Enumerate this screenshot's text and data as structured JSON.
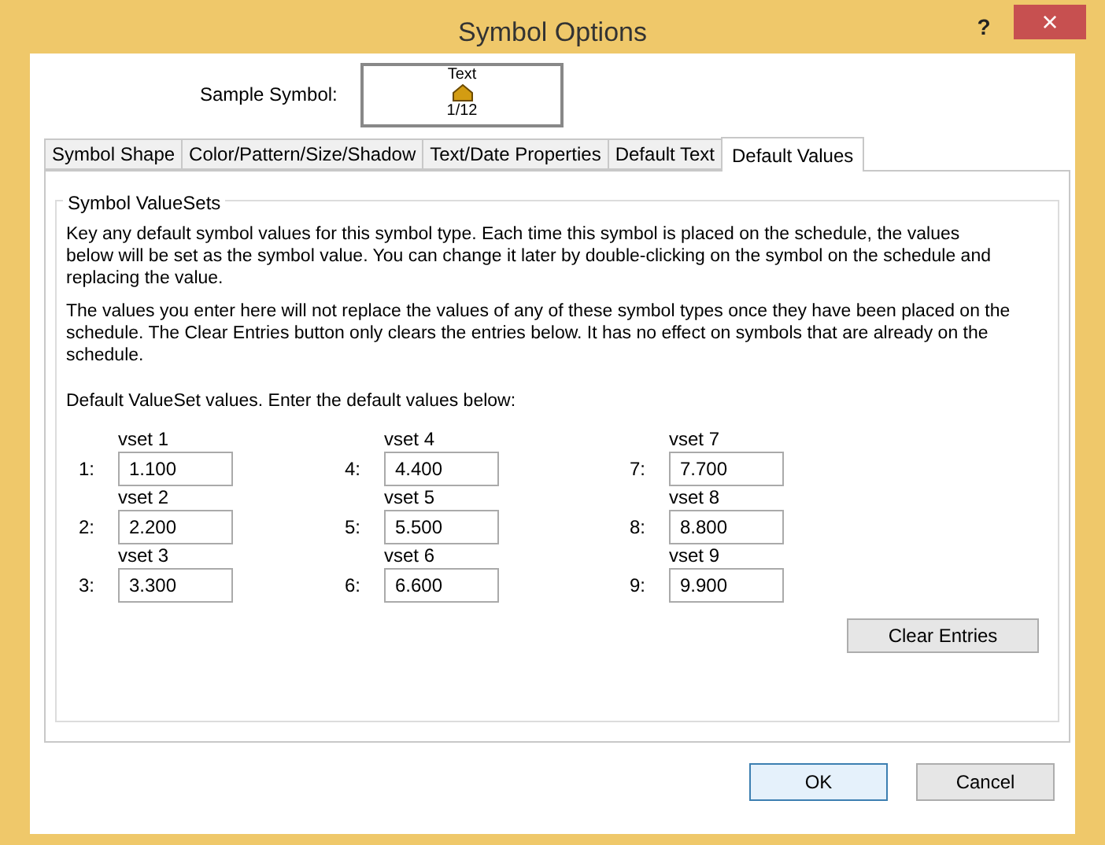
{
  "window": {
    "title": "Symbol Options",
    "help": "?",
    "close": "×"
  },
  "sample": {
    "label": "Sample Symbol:",
    "top_text": "Text",
    "bottom_text": "1/12"
  },
  "tabs": [
    {
      "label": "Symbol Shape",
      "selected": false
    },
    {
      "label": "Color/Pattern/Size/Shadow",
      "selected": false
    },
    {
      "label": "Text/Date Properties",
      "selected": false
    },
    {
      "label": "Default Text",
      "selected": false
    },
    {
      "label": "Default Values",
      "selected": true
    }
  ],
  "group": {
    "title": "Symbol ValueSets",
    "paragraphs": [
      "Key any default symbol values for this symbol type. Each time this symbol is placed on the schedule, the values below will be set as the symbol value. You can change it later by double-clicking on the symbol on the schedule and replacing the value.",
      "The values you enter here will not replace the values of any of these symbol types once they have been placed on the schedule. The Clear Entries button only clears the entries below. It has no effect on symbols that are already on the schedule."
    ],
    "prompt": "Default ValueSet values. Enter the default values below:",
    "columns": [
      [
        {
          "name": "vset 1",
          "index": "1:",
          "value": "1.100"
        },
        {
          "name": "vset 2",
          "index": "2:",
          "value": "2.200"
        },
        {
          "name": "vset 3",
          "index": "3:",
          "value": "3.300"
        }
      ],
      [
        {
          "name": "vset 4",
          "index": "4:",
          "value": "4.400"
        },
        {
          "name": "vset 5",
          "index": "5:",
          "value": "5.500"
        },
        {
          "name": "vset 6",
          "index": "6:",
          "value": "6.600"
        }
      ],
      [
        {
          "name": "vset 7",
          "index": "7:",
          "value": "7.700"
        },
        {
          "name": "vset 8",
          "index": "8:",
          "value": "8.800"
        },
        {
          "name": "vset 9",
          "index": "9:",
          "value": "9.900"
        }
      ]
    ],
    "clear_button": "Clear Entries"
  },
  "buttons": [
    {
      "label": "OK",
      "default": true
    },
    {
      "label": "Cancel",
      "default": false
    }
  ]
}
